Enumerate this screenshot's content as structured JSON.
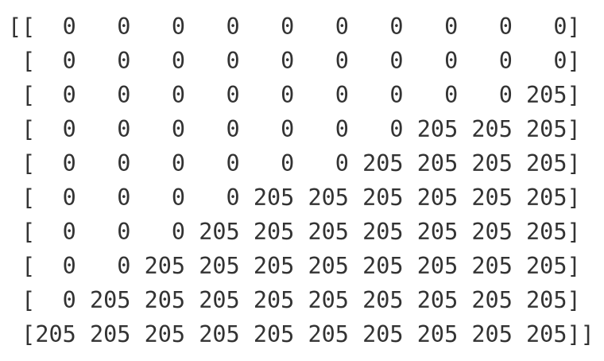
{
  "matrix_rows": [
    "[[  0   0   0   0   0   0   0   0   0   0]",
    " [  0   0   0   0   0   0   0   0   0   0]",
    " [  0   0   0   0   0   0   0   0   0 205]",
    " [  0   0   0   0   0   0   0 205 205 205]",
    " [  0   0   0   0   0   0 205 205 205 205]",
    " [  0   0   0   0 205 205 205 205 205 205]",
    " [  0   0   0 205 205 205 205 205 205 205]",
    " [  0   0 205 205 205 205 205 205 205 205]",
    " [  0 205 205 205 205 205 205 205 205 205]",
    " [205 205 205 205 205 205 205 205 205 205]]"
  ]
}
